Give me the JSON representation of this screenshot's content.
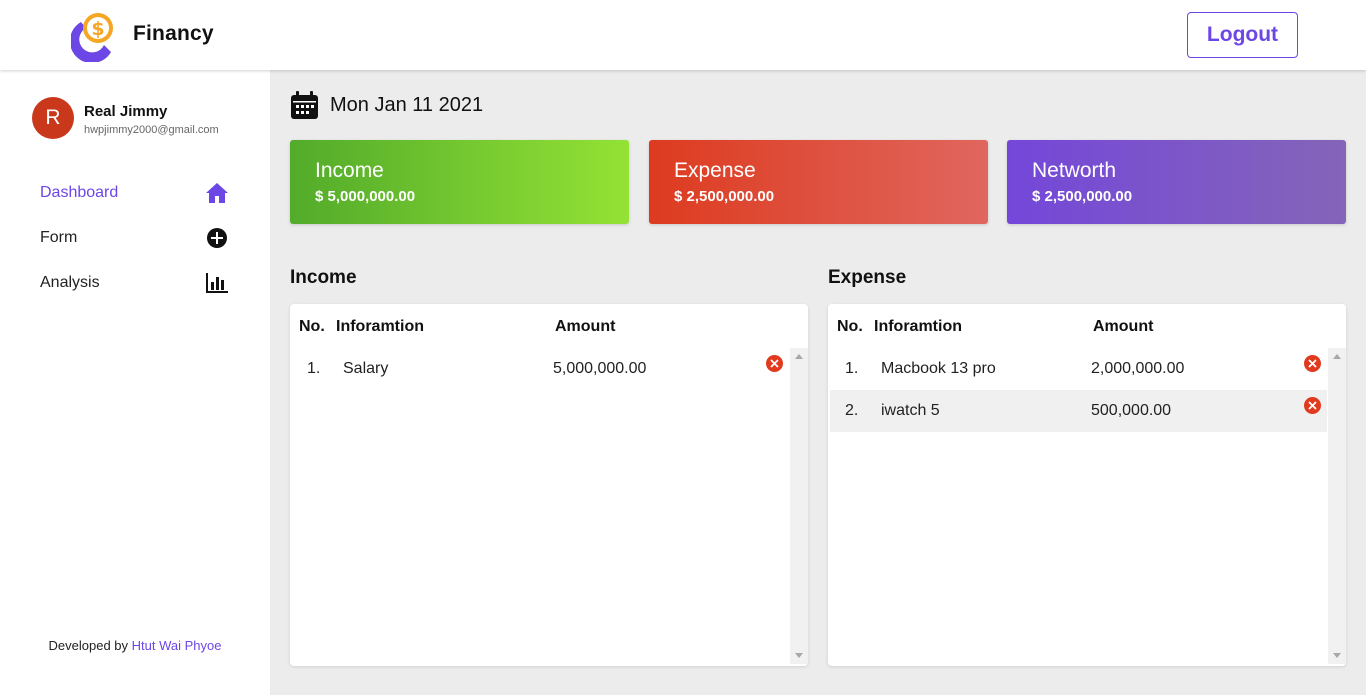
{
  "app": {
    "brand": "Financy",
    "logout_label": "Logout"
  },
  "user": {
    "initial": "R",
    "name": "Real Jimmy",
    "email": "hwpjimmy2000@gmail.com"
  },
  "nav": {
    "items": [
      {
        "label": "Dashboard",
        "icon": "home-icon",
        "active": true
      },
      {
        "label": "Form",
        "icon": "plus-circle-icon",
        "active": false
      },
      {
        "label": "Analysis",
        "icon": "bar-chart-icon",
        "active": false
      }
    ]
  },
  "footer": {
    "prefix": "Developed by",
    "author": "Htut Wai Phyoe"
  },
  "date": {
    "icon": "calendar-icon",
    "text": "Mon Jan 11 2021"
  },
  "cards": {
    "income": {
      "title": "Income",
      "value": "$ 5,000,000.00"
    },
    "expense": {
      "title": "Expense",
      "value": "$ 2,500,000.00"
    },
    "networth": {
      "title": "Networth",
      "value": "$ 2,500,000.00"
    }
  },
  "income_table": {
    "title": "Income",
    "headers": {
      "no": "No.",
      "info": "Inforamtion",
      "amount": "Amount"
    },
    "rows": [
      {
        "no": "1.",
        "info": "Salary",
        "amount": "5,000,000.00"
      }
    ]
  },
  "expense_table": {
    "title": "Expense",
    "headers": {
      "no": "No.",
      "info": "Inforamtion",
      "amount": "Amount"
    },
    "rows": [
      {
        "no": "1.",
        "info": "Macbook 13 pro",
        "amount": "2,000,000.00"
      },
      {
        "no": "2.",
        "info": "iwatch 5",
        "amount": "500,000.00"
      }
    ]
  },
  "colors": {
    "accent": "#6c47e6",
    "income_gradient": [
      "#52ab2a",
      "#94e235"
    ],
    "expense_gradient": [
      "#dd3b1f",
      "#e0665e"
    ],
    "networth_gradient": [
      "#7447d9",
      "#8465b8"
    ],
    "delete": "#e03b1f"
  }
}
